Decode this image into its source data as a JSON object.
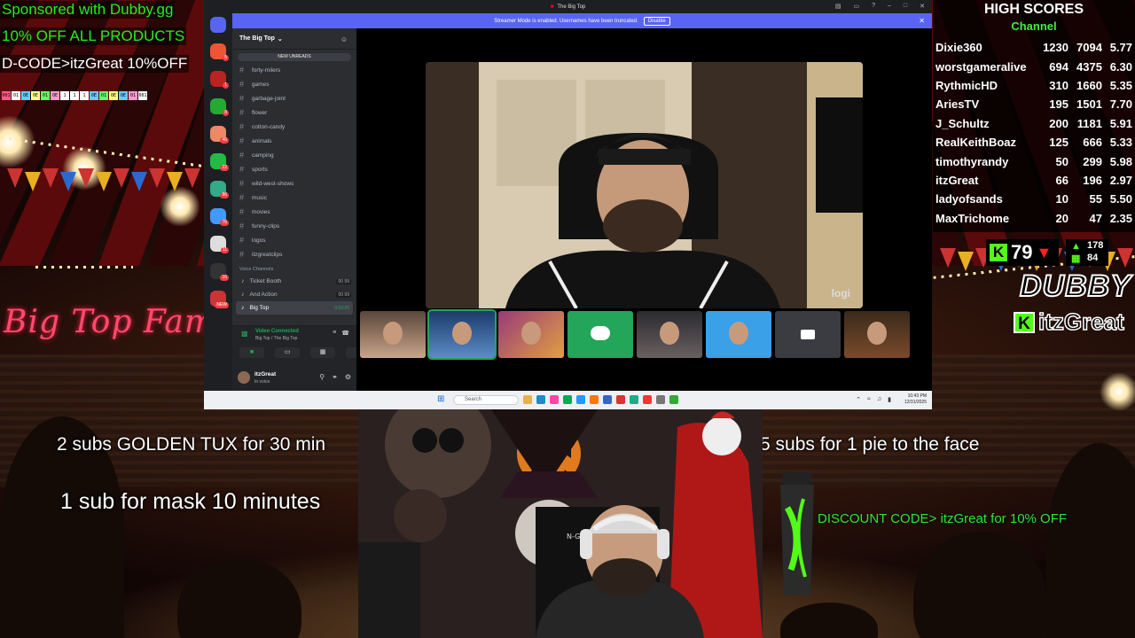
{
  "left_overlay": {
    "sponsor_line1": "Sponsored with Dubby.gg",
    "sponsor_line2": "10% OFF ALL PRODUCTS",
    "sponsor_line3": "D-CODE>itzGreat 10%OFF",
    "codes_row": [
      "001",
      "01",
      "0E",
      "0E",
      "01",
      "0E",
      "1",
      "1",
      "1",
      "0E",
      "01",
      "0E",
      "0E",
      "01",
      "001"
    ],
    "big_top_fam": "Big Top Fam"
  },
  "promos": {
    "golden_tux": "2 subs GOLDEN TUX for 30 min",
    "pie": "5 subs for 1 pie to the face",
    "mask": "1 sub for mask 10 minutes",
    "discount": "DISCOUNT CODE> itzGreat for 10% OFF"
  },
  "high_scores": {
    "title": "HIGH SCORES",
    "subtitle": "Channel",
    "rows": [
      {
        "name": "Dixie360",
        "a": "1230",
        "b": "7094",
        "c": "5.77"
      },
      {
        "name": "worstgameralive",
        "a": "694",
        "b": "4375",
        "c": "6.30"
      },
      {
        "name": "RythmicHD",
        "a": "310",
        "b": "1660",
        "c": "5.35"
      },
      {
        "name": "AriesTV",
        "a": "195",
        "b": "1501",
        "c": "7.70"
      },
      {
        "name": "J_Schultz",
        "a": "200",
        "b": "1181",
        "c": "5.91"
      },
      {
        "name": "RealKeithBoaz",
        "a": "125",
        "b": "666",
        "c": "5.33"
      },
      {
        "name": "timothyrandy",
        "a": "50",
        "b": "299",
        "c": "5.98"
      },
      {
        "name": "itzGreat",
        "a": "66",
        "b": "196",
        "c": "2.97"
      },
      {
        "name": "ladyofsands",
        "a": "10",
        "b": "55",
        "c": "5.50"
      },
      {
        "name": "MaxTrichome",
        "a": "20",
        "b": "47",
        "c": "2.35"
      }
    ]
  },
  "kick_stats": {
    "viewers": "79",
    "bar_top": "178",
    "bar_bottom": "84",
    "brand": "DUBBY",
    "handle": "itzGreat",
    "kick_letter": "K"
  },
  "discord": {
    "window_title": "The Big Top",
    "streamer_notice": "Streamer Mode is enabled. Usernames have been truncated.",
    "disable_label": "Disable",
    "guild_name": "The Big Top",
    "new_unreads": "NEW UNREADS",
    "text_channels": [
      "forty-milers",
      "games",
      "garbage-joint",
      "flower",
      "cotton-candy",
      "animals",
      "camping",
      "sports",
      "wild-west-shows",
      "music",
      "movies",
      "funny-clips",
      "logos",
      "itzgreatclips"
    ],
    "voice_header": "Voice Channels",
    "voice_channels": [
      {
        "name": "Ticket Booth",
        "tag": "00  99"
      },
      {
        "name": "And Action",
        "tag": "00  99"
      },
      {
        "name": "Big Top",
        "tag": "0:02:26"
      }
    ],
    "server_badges": [
      "5",
      "1",
      "8",
      "46",
      "22",
      "86",
      "76",
      "11",
      "16",
      "NEW"
    ],
    "video_connected": "Video Connected",
    "video_connected_sub": "Big Top / The Big Top",
    "username": "itzGreat",
    "user_status": "In voice",
    "cam_brand": "logi"
  },
  "taskbar": {
    "search_placeholder": "Search",
    "time": "10:43 PM",
    "date": "12/31/2025"
  },
  "colors": {
    "discord_blurple": "#5865f2",
    "kick_green": "#53fc18",
    "sponsor_green": "#22ee22",
    "big_top_pink": "#ff4a6a"
  }
}
